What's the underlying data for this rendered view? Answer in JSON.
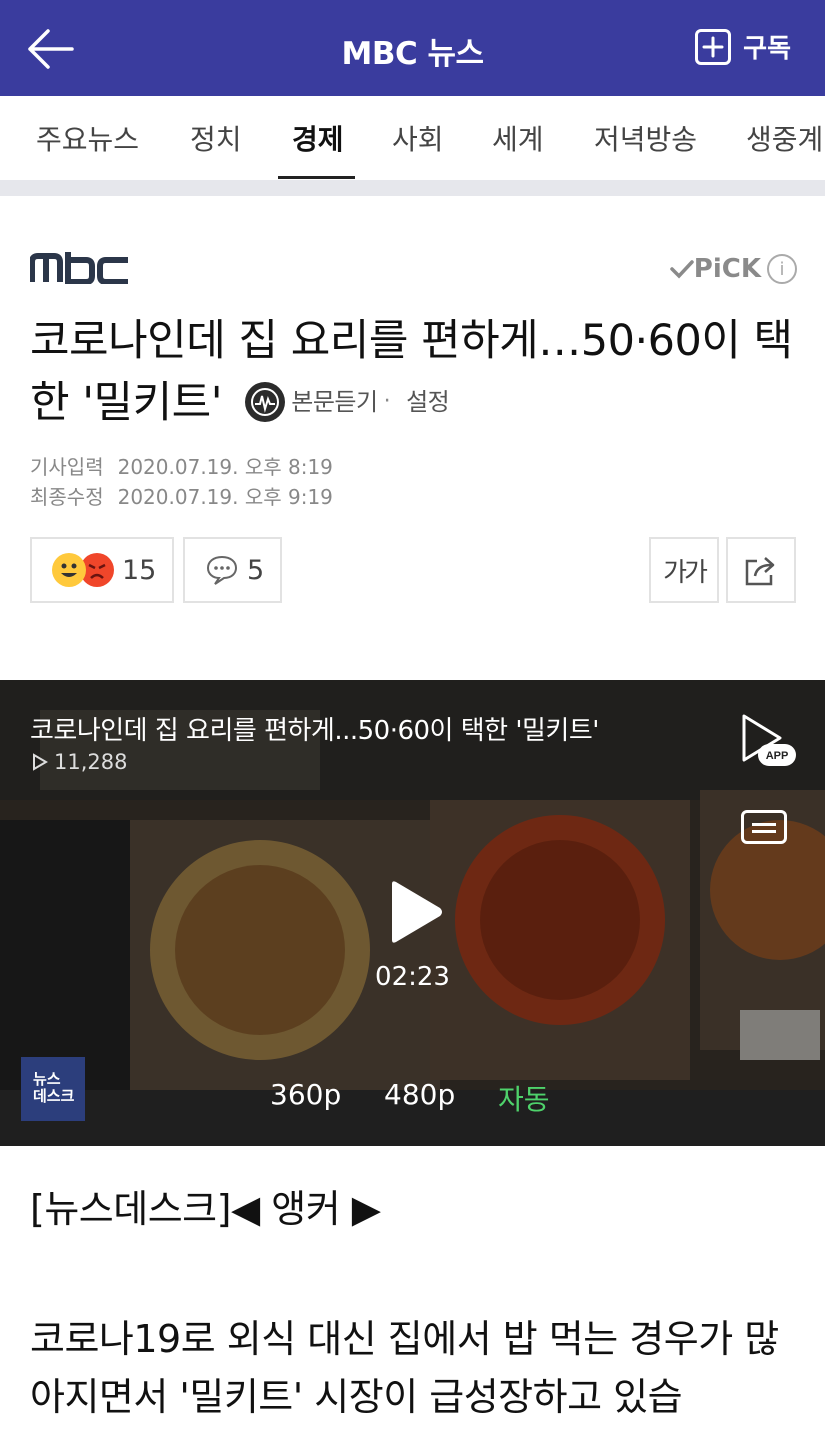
{
  "header": {
    "title": "MBC 뉴스",
    "subscribe_label": "구독",
    "back_icon": "arrow-left-icon",
    "background": "#3a3c9e"
  },
  "tabs": [
    {
      "label": "주요뉴스",
      "active": false
    },
    {
      "label": "정치",
      "active": false
    },
    {
      "label": "경제",
      "active": true
    },
    {
      "label": "사회",
      "active": false
    },
    {
      "label": "세계",
      "active": false
    },
    {
      "label": "저녁방송",
      "active": false
    },
    {
      "label": "생중계",
      "active": false
    }
  ],
  "article": {
    "publisher_logo": "MBC",
    "pick_label": "PiCK",
    "pick_info_icon": "i",
    "headline": "코로나인데 집 요리를 편하게…50·60이 택한 '밀키트'",
    "listen_label": "본문듣기",
    "dot": "·",
    "settings_label": "설정",
    "input_label": "기사입력",
    "input_date": "2020.07.19. 오후 8:19",
    "modified_label": "최종수정",
    "modified_date": "2020.07.19. 오후 9:19"
  },
  "reactions": {
    "emotion_count": "15",
    "comment_count": "5",
    "font_size_label": "가가"
  },
  "video": {
    "title": "코로나인데 집 요리를 편하게...50·60이 택한 '밀키트'",
    "views": "11,288",
    "duration": "02:23",
    "app_badge": "APP",
    "quality_options": [
      "360p",
      "480p",
      "자동"
    ],
    "selected_quality": "자동",
    "logo_text_line1": "뉴스",
    "logo_text_line2": "데스크"
  },
  "body": {
    "anchor": "[뉴스데스크]◀ 앵커 ▶",
    "paragraph": "코로나19로 외식 대신 집에서 밥 먹는 경우가 많아지면서 '밀키트' 시장이 급성장하고 있습"
  }
}
